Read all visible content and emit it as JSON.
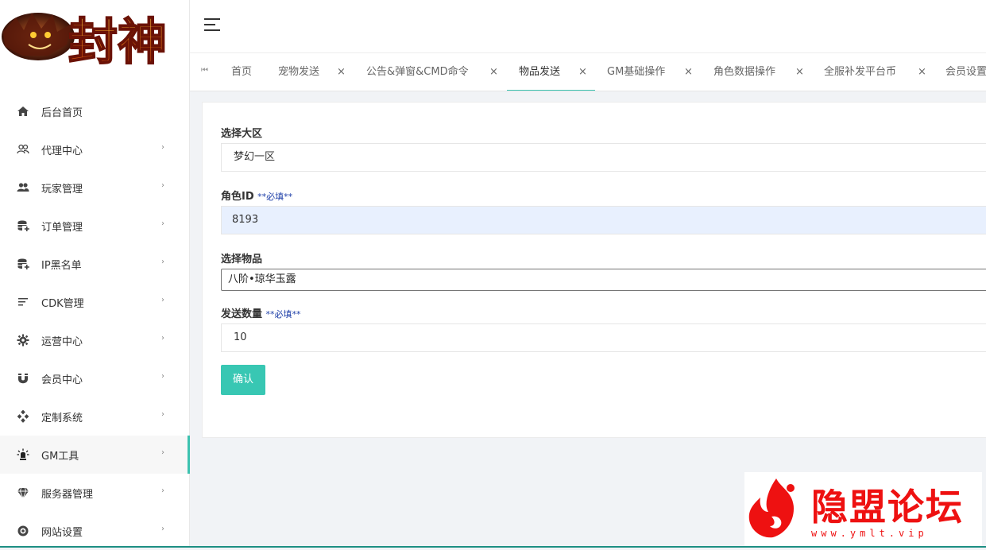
{
  "brand": {
    "logo_text": "封神"
  },
  "sidebar": {
    "items": [
      {
        "label": "后台首页",
        "icon": "home-icon",
        "has_arrow": false,
        "active": false
      },
      {
        "label": "代理中心",
        "icon": "users-outline-icon",
        "has_arrow": true,
        "active": false
      },
      {
        "label": "玩家管理",
        "icon": "users-icon",
        "has_arrow": true,
        "active": false
      },
      {
        "label": "订单管理",
        "icon": "database-add-icon",
        "has_arrow": true,
        "active": false
      },
      {
        "label": "IP黑名单",
        "icon": "database-add-icon",
        "has_arrow": true,
        "active": false
      },
      {
        "label": "CDK管理",
        "icon": "sort-lines-icon",
        "has_arrow": true,
        "active": false
      },
      {
        "label": "运营中心",
        "icon": "gear-icon",
        "has_arrow": true,
        "active": false
      },
      {
        "label": "会员中心",
        "icon": "magnet-icon",
        "has_arrow": true,
        "active": false
      },
      {
        "label": "定制系统",
        "icon": "diamonds-icon",
        "has_arrow": true,
        "active": false
      },
      {
        "label": "GM工具",
        "icon": "bulb-icon",
        "has_arrow": true,
        "active": true
      },
      {
        "label": "服务器管理",
        "icon": "diamond-icon",
        "has_arrow": true,
        "active": false
      },
      {
        "label": "网站设置",
        "icon": "globe-icon",
        "has_arrow": true,
        "active": false
      }
    ]
  },
  "tabs": {
    "first_icon": "⏮",
    "close_glyph": "×",
    "items": [
      {
        "label": "首页",
        "closable": false,
        "active": false
      },
      {
        "label": "宠物发送",
        "closable": true,
        "active": false
      },
      {
        "label": "公告&弹窗&CMD命令",
        "closable": true,
        "active": false
      },
      {
        "label": "物品发送",
        "closable": true,
        "active": true
      },
      {
        "label": "GM基础操作",
        "closable": true,
        "active": false
      },
      {
        "label": "角色数据操作",
        "closable": true,
        "active": false
      },
      {
        "label": "全服补发平台币",
        "closable": true,
        "active": false
      },
      {
        "label": "会员设置",
        "closable": false,
        "active": false
      }
    ]
  },
  "form": {
    "region_label": "选择大区",
    "region_value": "梦幻一区",
    "role_label": "角色ID",
    "role_required": "**必填**",
    "role_value": "8193",
    "item_label": "选择物品",
    "item_value": "八阶•琼华玉露",
    "qty_label": "发送数量",
    "qty_required": "**必填**",
    "qty_value": "10",
    "confirm_label": "确认"
  },
  "watermark": {
    "title": "隐盟论坛",
    "url": "www.ymlt.vip"
  },
  "colors": {
    "accent": "#3dc2b0",
    "button": "#38c7b3",
    "required": "#1e3fa8",
    "watermark": "#e11111"
  }
}
